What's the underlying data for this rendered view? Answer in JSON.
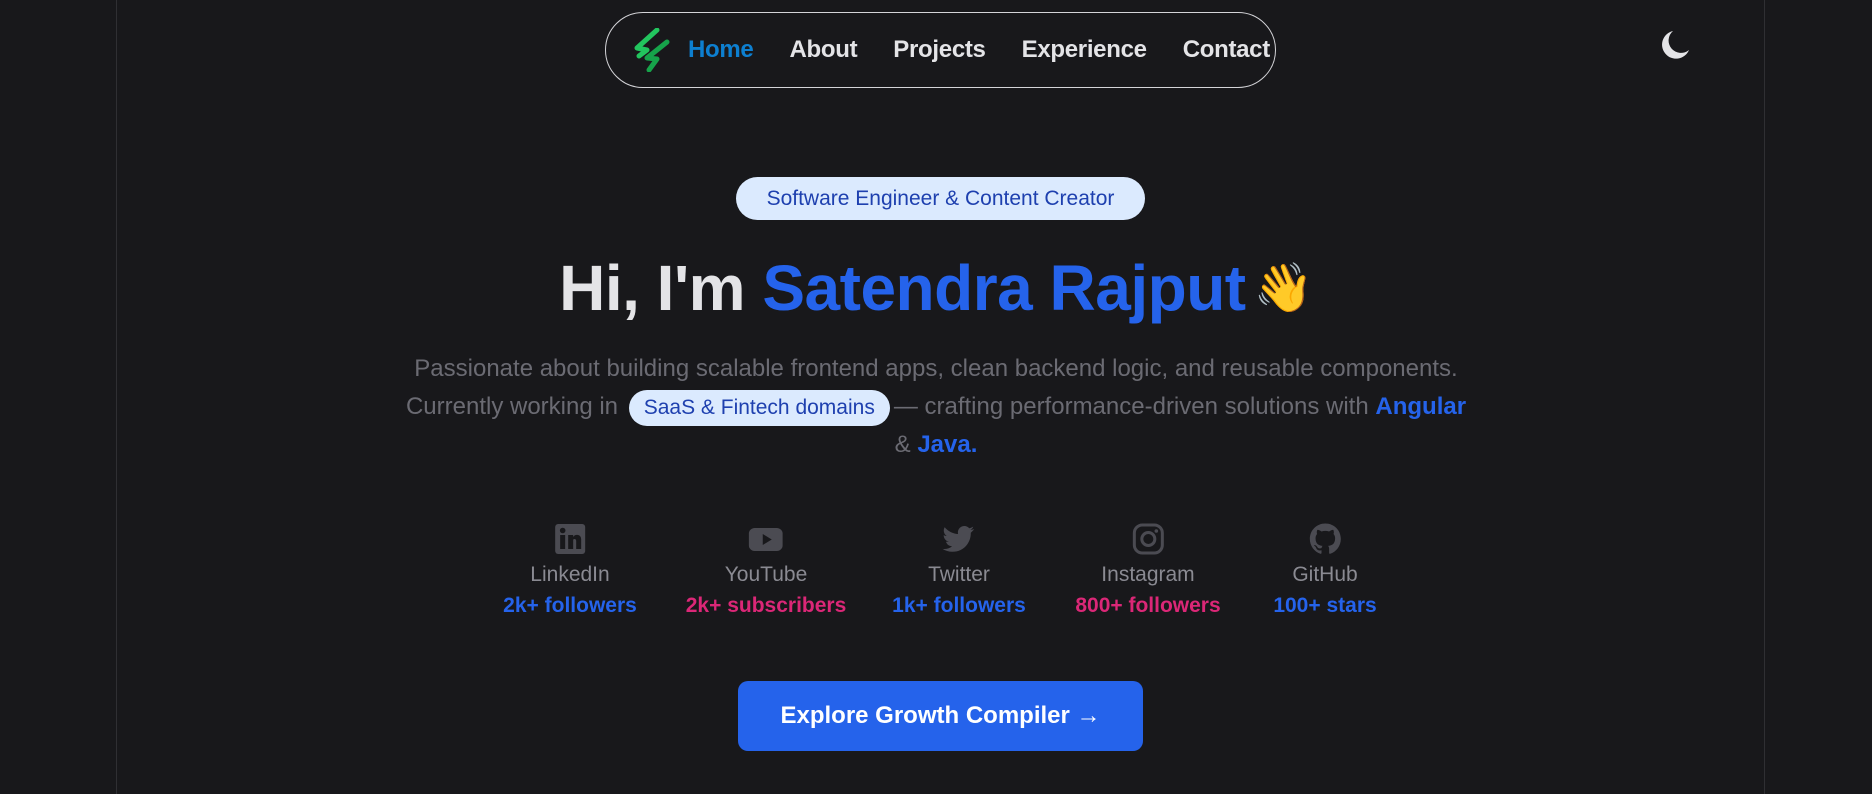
{
  "nav": {
    "logo_icon": "lightning-logo-icon",
    "items": [
      {
        "label": "Home",
        "active": true
      },
      {
        "label": "About",
        "active": false
      },
      {
        "label": "Projects",
        "active": false
      },
      {
        "label": "Experience",
        "active": false
      },
      {
        "label": "Contact",
        "active": false
      }
    ],
    "theme_icon": "moon-icon"
  },
  "hero": {
    "badge": "Software Engineer & Content Creator",
    "greeting": "Hi, I'm",
    "name": "Satendra Rajput",
    "wave": "👋",
    "desc_line1": "Passionate about building scalable frontend apps, clean backend logic, and reusable components.",
    "desc_prefix": "Currently working in",
    "domain_pill": "SaaS & Fintech domains",
    "desc_mid": "— crafting performance-driven solutions with",
    "tech1": "Angular",
    "amp": "&",
    "tech2": "Java."
  },
  "socials": [
    {
      "name": "LinkedIn",
      "count": "2k+ followers",
      "icon": "linkedin-icon",
      "color": "blue"
    },
    {
      "name": "YouTube",
      "count": "2k+ subscribers",
      "icon": "youtube-icon",
      "color": "pink"
    },
    {
      "name": "Twitter",
      "count": "1k+ followers",
      "icon": "twitter-icon",
      "color": "blue"
    },
    {
      "name": "Instagram",
      "count": "800+ followers",
      "icon": "instagram-icon",
      "color": "pink"
    },
    {
      "name": "GitHub",
      "count": "100+ stars",
      "icon": "github-icon",
      "color": "blue"
    }
  ],
  "cta": {
    "label": "Explore Growth Compiler →"
  },
  "colors": {
    "background": "#18181b",
    "accent": "#2563eb",
    "accent_pink": "#db2777",
    "nav_active": "#0d7fd0",
    "badge_bg": "#dbeafe",
    "logo_green": "#22c55e"
  }
}
